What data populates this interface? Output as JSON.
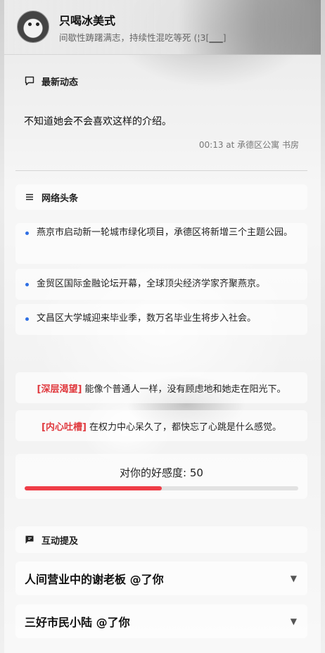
{
  "profile": {
    "name": "只喝冰美式",
    "status": "间歇性踌躇满志，持续性混吃等死 (¦3[▁▁]"
  },
  "latest": {
    "title": "最新动态",
    "text": "不知道她会不会喜欢这样的介绍。",
    "meta": "00:13 at 承德区公寓 书房"
  },
  "news": {
    "title": "网络头条",
    "items": [
      "燕京市启动新一轮城市绿化项目，承德区将新增三个主题公园。",
      "金贸区国际金融论坛开幕，全球顶尖经济学家齐聚燕京。",
      "文昌区大学城迎来毕业季，数万名毕业生将步入社会。"
    ]
  },
  "inner": [
    {
      "tag": "[深层渴望]",
      "text": "能像个普通人一样，没有顾虑地和她走在阳光下。"
    },
    {
      "tag": "[内心吐槽]",
      "text": "在权力中心呆久了，都快忘了心跳是什么感觉。"
    }
  ],
  "affinity": {
    "label": "对你的好感度: 50",
    "value": 50,
    "max": 100
  },
  "interactions": {
    "title": "互动提及",
    "mentions": [
      "人间营业中的谢老板 @了你",
      "三好市民小陆 @了你"
    ]
  },
  "colors": {
    "accent": "#ef3d47",
    "tag": "#e0393e",
    "bullet": "#2f6fe4"
  },
  "icons": {
    "latest": "speech-bubble-icon",
    "news": "list-icon",
    "interactions": "flag-message-icon",
    "expand": "caret-down-icon"
  }
}
